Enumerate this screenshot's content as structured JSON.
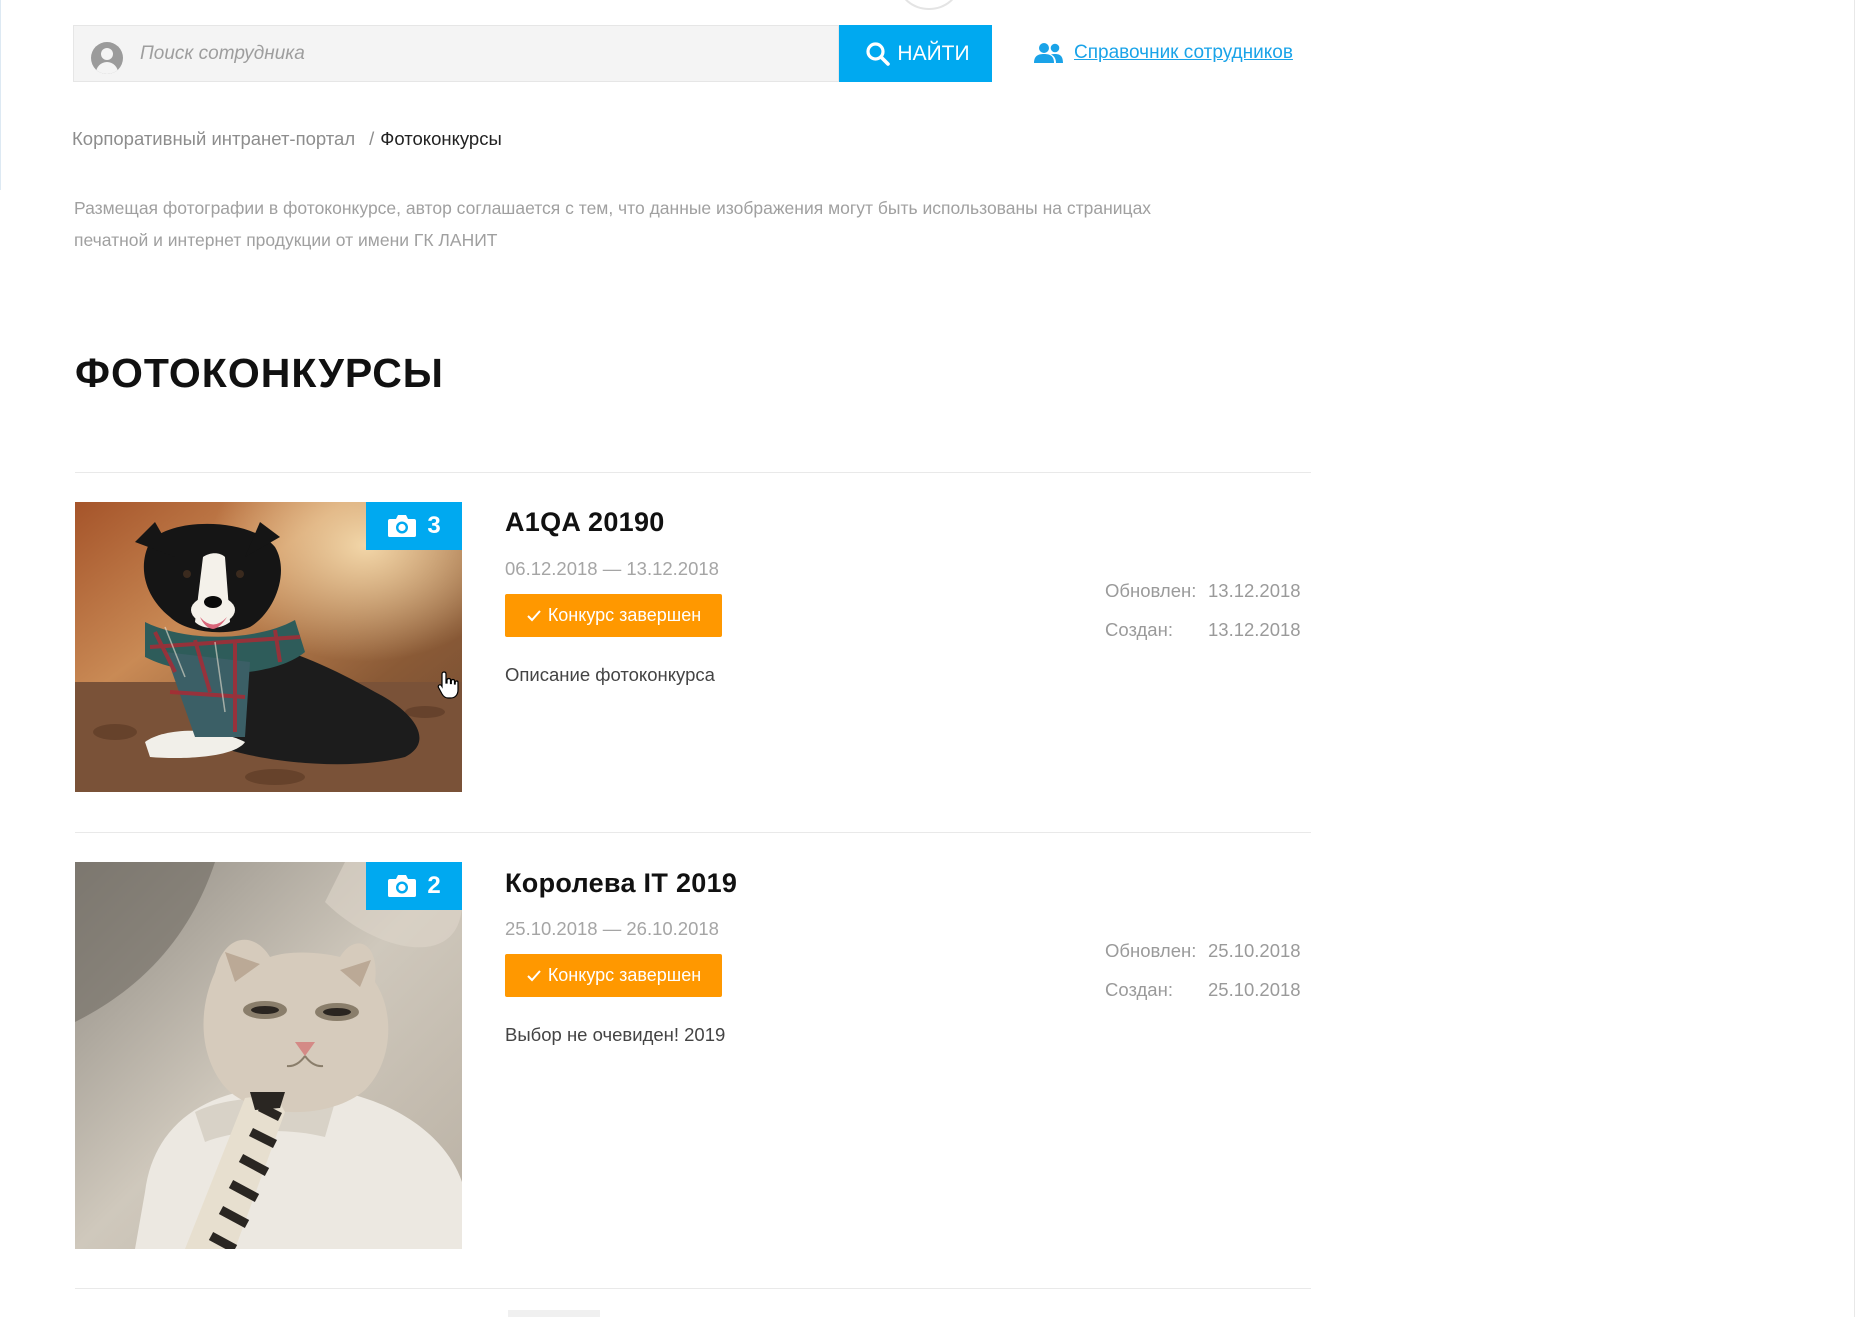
{
  "search": {
    "placeholder": "Поиск сотрудника",
    "value": "",
    "button_label": "НАЙТИ"
  },
  "header": {
    "directory_link": "Справочник сотрудников"
  },
  "breadcrumb": {
    "home": "Корпоративный интранет-портал",
    "separator": "/",
    "current": "Фотоконкурсы"
  },
  "notice": {
    "line1": "Размещая фотографии в фотоконкурсе, автор соглашается с тем, что данные изображения могут быть использованы на страницах",
    "line2": "печатной и интернет продукции от имени ГК ЛАНИТ"
  },
  "page_title": "ФОТОКОНКУРСЫ",
  "contests": [
    {
      "title": "A1QA 20190",
      "dates": "06.12.2018 — 13.12.2018",
      "status": "Конкурс завершен",
      "description": "Описание фотоконкурса",
      "photo_count": "3",
      "updated_label": "Обновлен:",
      "updated": "13.12.2018",
      "created_label": "Создан:",
      "created": "13.12.2018"
    },
    {
      "title": "Королева IT 2019",
      "dates": "25.10.2018 — 26.10.2018",
      "status": "Конкурс завершен",
      "description": "Выбор не очевиден! 2019",
      "photo_count": "2",
      "updated_label": "Обновлен:",
      "updated": "25.10.2018",
      "created_label": "Создан:",
      "created": "25.10.2018"
    }
  ],
  "colors": {
    "accent": "#00a9f0",
    "link": "#1aa3e8",
    "status": "#ff9800"
  },
  "icons": {
    "search": "search-icon",
    "user": "user-avatar-icon",
    "people": "people-icon",
    "camera": "camera-icon",
    "check": "check-icon"
  }
}
